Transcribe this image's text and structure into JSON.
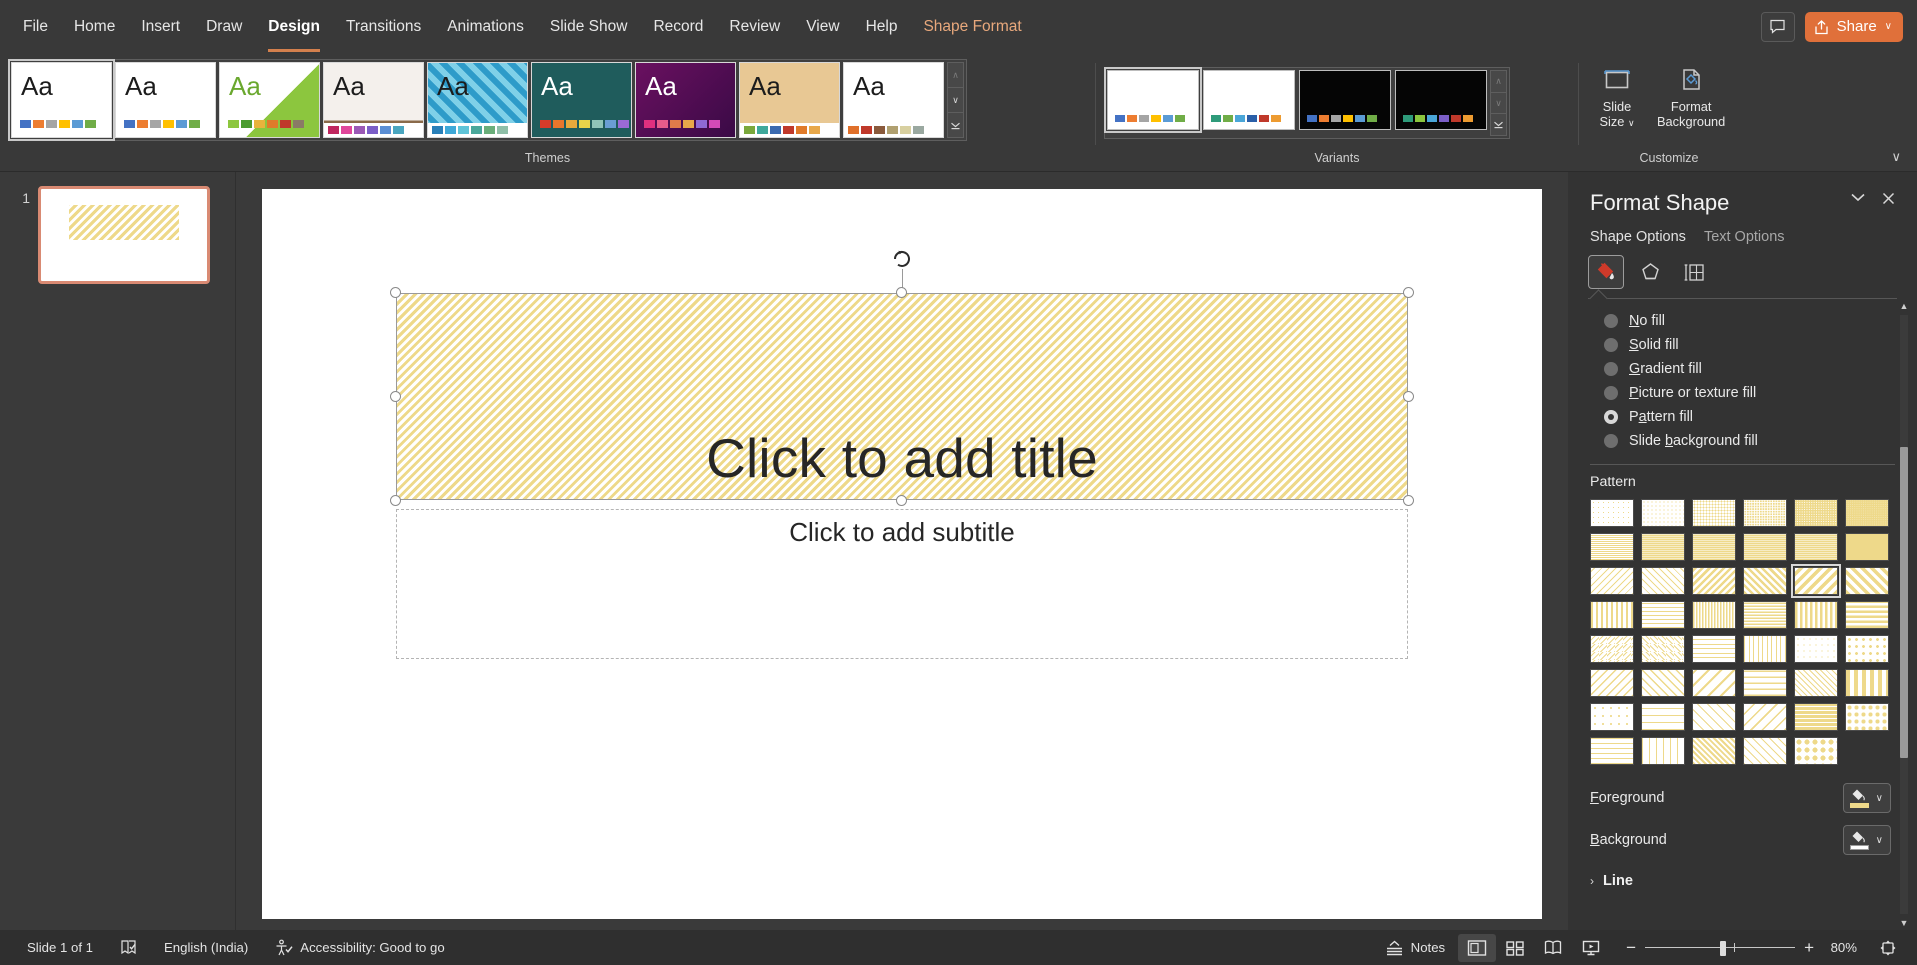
{
  "window": {
    "tabs": [
      {
        "label": "File",
        "active": false,
        "contextual": false
      },
      {
        "label": "Home",
        "active": false,
        "contextual": false
      },
      {
        "label": "Insert",
        "active": false,
        "contextual": false
      },
      {
        "label": "Draw",
        "active": false,
        "contextual": false
      },
      {
        "label": "Design",
        "active": true,
        "contextual": false
      },
      {
        "label": "Transitions",
        "active": false,
        "contextual": false
      },
      {
        "label": "Animations",
        "active": false,
        "contextual": false
      },
      {
        "label": "Slide Show",
        "active": false,
        "contextual": false
      },
      {
        "label": "Record",
        "active": false,
        "contextual": false
      },
      {
        "label": "Review",
        "active": false,
        "contextual": false
      },
      {
        "label": "View",
        "active": false,
        "contextual": false
      },
      {
        "label": "Help",
        "active": false,
        "contextual": false
      },
      {
        "label": "Shape Format",
        "active": false,
        "contextual": true
      }
    ],
    "comments_icon": "comment-icon",
    "share_label": "Share",
    "share_icon": "share-icon",
    "share_color": "#e0703a",
    "share_chevron": "∨"
  },
  "ribbon": {
    "themes_group_label": "Themes",
    "variants_group_label": "Variants",
    "customize_group_label": "Customize",
    "collapse_icon": "chevron-down-icon",
    "themes": [
      {
        "name": "office-theme",
        "selected": true,
        "bg": "#ffffff",
        "style": "plain",
        "swatches": [
          "#4472c4",
          "#ed7d31",
          "#a5a5a5",
          "#ffc000",
          "#5b9bd5",
          "#70ad47"
        ]
      },
      {
        "name": "office-theme-2",
        "selected": false,
        "bg": "#ffffff",
        "style": "plain",
        "swatches": [
          "#4472c4",
          "#ed7d31",
          "#a5a5a5",
          "#ffc000",
          "#5b9bd5",
          "#70ad47"
        ]
      },
      {
        "name": "berlin-theme",
        "selected": false,
        "bg": "#ffffff",
        "style": "green-chevron",
        "swatches": [
          "#8cc63e",
          "#4a9b2f",
          "#e8b33c",
          "#e07b2a",
          "#c0392b",
          "#8a7a66"
        ]
      },
      {
        "name": "wisp-theme",
        "selected": false,
        "bg": "#f4f0ec",
        "style": "wood-strip",
        "swatches": [
          "#c0275f",
          "#e0479b",
          "#9b59b6",
          "#7b5ec7",
          "#5b8fd5",
          "#4aa6c0"
        ]
      },
      {
        "name": "quotable-theme",
        "selected": false,
        "bg": "#2e9bc9",
        "style": "blue-diamond",
        "swatches": [
          "#2980b9",
          "#3fa9d8",
          "#5fc4d8",
          "#4aa89b",
          "#6aae7a",
          "#8fbfa8"
        ]
      },
      {
        "name": "ion-theme",
        "selected": false,
        "bg": "#1f5c5c",
        "style": "teal-dark",
        "swatches": [
          "#d63b2a",
          "#e8762c",
          "#e8a93c",
          "#e8d44a",
          "#8fc4b8",
          "#6a9ed4",
          "#9b6ad4"
        ]
      },
      {
        "name": "badge-theme",
        "selected": false,
        "bg": "#4a0f52",
        "style": "purple-dark",
        "swatches": [
          "#e0307f",
          "#e85c8a",
          "#e07b4a",
          "#e8a84a",
          "#8f6ad4",
          "#d44ab8"
        ]
      },
      {
        "name": "wood-type-theme",
        "selected": false,
        "bg": "#e8c894",
        "style": "wood-tan",
        "swatches": [
          "#7aa83c",
          "#3fa89b",
          "#3a6ab0",
          "#c0392b",
          "#e07b2a",
          "#e8a84a"
        ]
      },
      {
        "name": "facet-theme",
        "selected": false,
        "bg": "#ffffff",
        "style": "orange-base",
        "swatches": [
          "#e0702a",
          "#c0392b",
          "#8a5a3c",
          "#b0a070",
          "#d8d0a0",
          "#9aa8a0"
        ]
      }
    ],
    "variants": [
      {
        "name": "variant-1",
        "selected": true,
        "bg": "#ffffff",
        "swatches": [
          "#4472c4",
          "#ed7d31",
          "#a5a5a5",
          "#ffc000",
          "#5b9bd5",
          "#70ad47"
        ]
      },
      {
        "name": "variant-2",
        "selected": false,
        "bg": "#ffffff",
        "swatches": [
          "#2e9b7a",
          "#70ad47",
          "#4aa6d8",
          "#2b5fa8",
          "#c0392b",
          "#ed9b31"
        ]
      },
      {
        "name": "variant-3",
        "selected": false,
        "bg": "#050505",
        "swatches": [
          "#4472c4",
          "#ed7d31",
          "#a5a5a5",
          "#ffc000",
          "#5b9bd5",
          "#70ad47"
        ]
      },
      {
        "name": "variant-4",
        "selected": false,
        "bg": "#050505",
        "swatches": [
          "#2e9b7a",
          "#8cc63e",
          "#4aa6d8",
          "#7b5ec7",
          "#c0392b",
          "#ed9b31"
        ]
      }
    ],
    "customize": {
      "slide_size_label": "Slide\nSize",
      "slide_size_label_l1": "Slide",
      "slide_size_label_l2": "Size",
      "slide_size_icon": "slide-size-icon",
      "slide_size_chevron": "∨",
      "format_background_l1": "Format",
      "format_background_l2": "Background",
      "format_background_icon": "format-background-icon"
    },
    "gallery_scroll": {
      "up": "∧",
      "down": "∨",
      "more": "⍗"
    }
  },
  "slides_panel": {
    "slides": [
      {
        "number": "1",
        "selected": true
      }
    ]
  },
  "canvas": {
    "title_placeholder": "Click to add title",
    "subtitle_placeholder": "Click to add subtitle",
    "rotation_handle_icon": "rotate-icon",
    "fill_pattern": "wide-upward-diagonal",
    "fill_foreground": "#eed98a",
    "fill_background": "#ffffff"
  },
  "format_shape": {
    "title": "Format Shape",
    "collapse_icon": "chevron-down-icon",
    "close_icon": "close-icon",
    "tabs": [
      {
        "label": "Shape Options",
        "active": true
      },
      {
        "label": "Text Options",
        "active": false
      }
    ],
    "icon_tabs": [
      {
        "name": "fill-and-line-icon",
        "selected": true
      },
      {
        "name": "effects-icon",
        "selected": false
      },
      {
        "name": "size-and-properties-icon",
        "selected": false
      }
    ],
    "fill_options": [
      {
        "label": "No fill",
        "accel": "N",
        "selected": false
      },
      {
        "label": "Solid fill",
        "accel": "S",
        "selected": false
      },
      {
        "label": "Gradient fill",
        "accel": "G",
        "selected": false
      },
      {
        "label": "Picture or texture fill",
        "accel": "P",
        "selected": false
      },
      {
        "label": "Pattern fill",
        "accel": "a",
        "selected": true
      },
      {
        "label": "Slide background fill",
        "accel": "b",
        "selected": false
      }
    ],
    "pattern_label": "Pattern",
    "pattern_selected_index": 16,
    "patterns": [
      {
        "name": "5-percent",
        "css": "radial-gradient(#eed98a 0.5px, #ffffff 0.6px)",
        "size": "5px 5px"
      },
      {
        "name": "10-percent",
        "css": "radial-gradient(#eed98a 0.7px, #ffffff 0.8px)",
        "size": "4px 4px"
      },
      {
        "name": "20-percent",
        "css": "radial-gradient(#eed98a 0.9px, #ffffff 1px)",
        "size": "3px 3px"
      },
      {
        "name": "25-percent",
        "css": "radial-gradient(#eed98a 1px, #ffffff 1.1px)",
        "size": "2.6px 2.6px"
      },
      {
        "name": "30-percent",
        "css": "radial-gradient(#eed98a 1.1px, #ffffff 1.2px)",
        "size": "2.4px 2.4px"
      },
      {
        "name": "40-percent",
        "css": "radial-gradient(#eed98a 1.2px, #ffffff 1.3px)",
        "size": "2.2px 2.2px"
      },
      {
        "name": "50-percent",
        "css": "repeating-linear-gradient(0deg,#eed98a 0 1px,#ffffff 1px 2px)",
        "size": "auto"
      },
      {
        "name": "60-percent",
        "css": "repeating-linear-gradient(0deg,#eed98a 0 1.3px,#ffffff 1.3px 2px)",
        "size": "auto"
      },
      {
        "name": "70-percent",
        "css": "repeating-linear-gradient(0deg,#eed98a 0 1.5px,#ffffff 1.5px 2px)",
        "size": "auto"
      },
      {
        "name": "75-percent",
        "css": "repeating-linear-gradient(0deg,#eed98a 0 1.6px,#ffffff 1.6px 2px)",
        "size": "auto"
      },
      {
        "name": "80-percent",
        "css": "repeating-linear-gradient(0deg,#eed98a 0 1.75px,#ffffff 1.75px 2px)",
        "size": "auto"
      },
      {
        "name": "90-percent",
        "css": "repeating-linear-gradient(0deg,#eed98a 0 1.9px,#ffffff 1.9px 2px)",
        "size": "auto"
      },
      {
        "name": "light-downward-diagonal",
        "css": "repeating-linear-gradient(-45deg,#eed98a 0 1px,#ffffff 1px 5px)",
        "size": "auto"
      },
      {
        "name": "light-upward-diagonal",
        "css": "repeating-linear-gradient(45deg,#eed98a 0 1px,#ffffff 1px 5px)",
        "size": "auto"
      },
      {
        "name": "dark-downward-diagonal",
        "css": "repeating-linear-gradient(-45deg,#eed98a 0 2.5px,#ffffff 2.5px 5px)",
        "size": "auto"
      },
      {
        "name": "dark-upward-diagonal",
        "css": "repeating-linear-gradient(45deg,#eed98a 0 2.5px,#ffffff 2.5px 5px)",
        "size": "auto"
      },
      {
        "name": "wide-upward-diagonal",
        "css": "repeating-linear-gradient(-45deg,#eed98a 0 3.5px,#ffffff 3.5px 7px)",
        "size": "auto"
      },
      {
        "name": "wide-downward-diagonal",
        "css": "repeating-linear-gradient(45deg,#eed98a 0 3.5px,#ffffff 3.5px 7px)",
        "size": "auto"
      },
      {
        "name": "light-vertical",
        "css": "repeating-linear-gradient(90deg,#eed98a 0 2px,#ffffff 2px 5px)",
        "size": "auto"
      },
      {
        "name": "light-horizontal",
        "css": "repeating-linear-gradient(0deg,#eed98a 0 1px,#ffffff 1px 4px)",
        "size": "auto"
      },
      {
        "name": "narrow-vertical",
        "css": "repeating-linear-gradient(90deg,#eed98a 0 1.5px,#ffffff 1.5px 3px)",
        "size": "auto"
      },
      {
        "name": "narrow-horizontal",
        "css": "repeating-linear-gradient(0deg,#eed98a 0 1.5px,#ffffff 1.5px 3px)",
        "size": "auto"
      },
      {
        "name": "dark-vertical",
        "css": "repeating-linear-gradient(90deg,#eed98a 0 2.5px,#ffffff 2.5px 5px)",
        "size": "auto"
      },
      {
        "name": "dark-horizontal",
        "css": "repeating-linear-gradient(0deg,#eed98a 0 2.5px,#ffffff 2.5px 5px)",
        "size": "auto"
      },
      {
        "name": "dashed-downward-diagonal",
        "css": "repeating-linear-gradient(-45deg,#eed98a 0 1px,#ffffff 1px 4px)",
        "size": "8px 8px"
      },
      {
        "name": "dashed-upward-diagonal",
        "css": "repeating-linear-gradient(45deg,#eed98a 0 1px,#ffffff 1px 4px)",
        "size": "8px 8px"
      },
      {
        "name": "dashed-horizontal",
        "css": "repeating-linear-gradient(0deg,#eed98a 0 1px,#ffffff 1px 5px)",
        "size": "9px 9px"
      },
      {
        "name": "dashed-vertical",
        "css": "repeating-linear-gradient(90deg,#eed98a 0 1px,#ffffff 1px 5px)",
        "size": "9px 9px"
      },
      {
        "name": "small-confetti",
        "css": "radial-gradient(#eed98a 0.7px, #ffffff 0.8px)",
        "size": "6px 6px"
      },
      {
        "name": "large-confetti",
        "css": "radial-gradient(#eed98a 1.4px, #ffffff 1.5px)",
        "size": "7px 7px"
      },
      {
        "name": "zigzag",
        "css": "repeating-linear-gradient(-45deg,#eed98a 0 1.2px,#ffffff 1.2px 6px)",
        "size": "auto"
      },
      {
        "name": "wave",
        "css": "repeating-linear-gradient(45deg,#eed98a 0 1.2px,#ffffff 1.2px 6px)",
        "size": "auto"
      },
      {
        "name": "diagonal-brick",
        "css": "repeating-linear-gradient(-45deg,#eed98a 0 2px,#ffffff 2px 9px)",
        "size": "auto"
      },
      {
        "name": "horizontal-brick",
        "css": "repeating-linear-gradient(0deg,#eed98a 0 1.5px,#ffffff 1.5px 6px)",
        "size": "auto"
      },
      {
        "name": "weave",
        "css": "repeating-linear-gradient(45deg,#eed98a 0 1px,#ffffff 1px 4px)",
        "size": "auto"
      },
      {
        "name": "plaid",
        "css": "repeating-linear-gradient(90deg,#eed98a 0 4px,#ffffff 4px 8px)",
        "size": "auto"
      },
      {
        "name": "divot",
        "css": "radial-gradient(#eed98a 1px, #ffffff 1.1px)",
        "size": "8px 8px"
      },
      {
        "name": "dotted-grid",
        "css": "repeating-linear-gradient(0deg,#eed98a 0 1px,#ffffff 1px 7px)",
        "size": "auto"
      },
      {
        "name": "dotted-diamond",
        "css": "repeating-linear-gradient(45deg,#eed98a 0 1px,#ffffff 1px 7px)",
        "size": "auto"
      },
      {
        "name": "shingle",
        "css": "repeating-linear-gradient(-45deg,#eed98a 0 1.5px,#ffffff 1.5px 8px)",
        "size": "auto"
      },
      {
        "name": "trellis",
        "css": "repeating-linear-gradient(0deg,#eed98a 0 3px,#ffffff 3px 4px)",
        "size": "auto"
      },
      {
        "name": "sphere",
        "css": "radial-gradient(#eed98a 2px, #ffffff 2.2px)",
        "size": "7px 7px"
      },
      {
        "name": "small-grid",
        "css": "repeating-linear-gradient(0deg,#eed98a 0 1px,#ffffff 1px 5px)",
        "size": "auto"
      },
      {
        "name": "large-grid",
        "css": "repeating-linear-gradient(90deg,#eed98a 0 1px,#ffffff 1px 7px)",
        "size": "auto"
      },
      {
        "name": "small-checker-board",
        "css": "repeating-linear-gradient(45deg,#eed98a 0 2px,#ffffff 2px 4px)",
        "size": "auto"
      },
      {
        "name": "outlined-diamond",
        "css": "repeating-linear-gradient(45deg,#eed98a 0 1px,#ffffff 1px 6px)",
        "size": "auto"
      },
      {
        "name": "solid-diamond",
        "css": "radial-gradient(#eed98a 2.4px, #ffffff 2.6px)",
        "size": "8px 8px"
      }
    ],
    "foreground_label": "Foreground",
    "foreground_accel": "F",
    "foreground_color": "#eed98a",
    "background_label": "Background",
    "background_accel": "B",
    "background_color": "#ffffff",
    "fill_icon": "paint-bucket-icon",
    "dropdown_chevron": "∨",
    "line_label": "Line",
    "line_chevron": "›",
    "scroll_up": "▲",
    "scroll_down": "▼"
  },
  "status_bar": {
    "slide_count": "Slide 1 of 1",
    "spellcheck_icon": "spellcheck-icon",
    "language": "English (India)",
    "accessibility_icon": "accessibility-icon",
    "accessibility": "Accessibility: Good to go",
    "notes_label": "Notes",
    "notes_icon": "notes-icon",
    "views": [
      {
        "name": "normal-view",
        "icon": "normal-view-icon",
        "active": true
      },
      {
        "name": "slide-sorter-view",
        "icon": "slide-sorter-icon",
        "active": false
      },
      {
        "name": "reading-view",
        "icon": "reading-view-icon",
        "active": false
      },
      {
        "name": "slide-show-view",
        "icon": "slide-show-icon",
        "active": false
      }
    ],
    "zoom_out": "−",
    "zoom_in": "+",
    "zoom_level": "80%",
    "fit_icon": "fit-to-window-icon"
  }
}
